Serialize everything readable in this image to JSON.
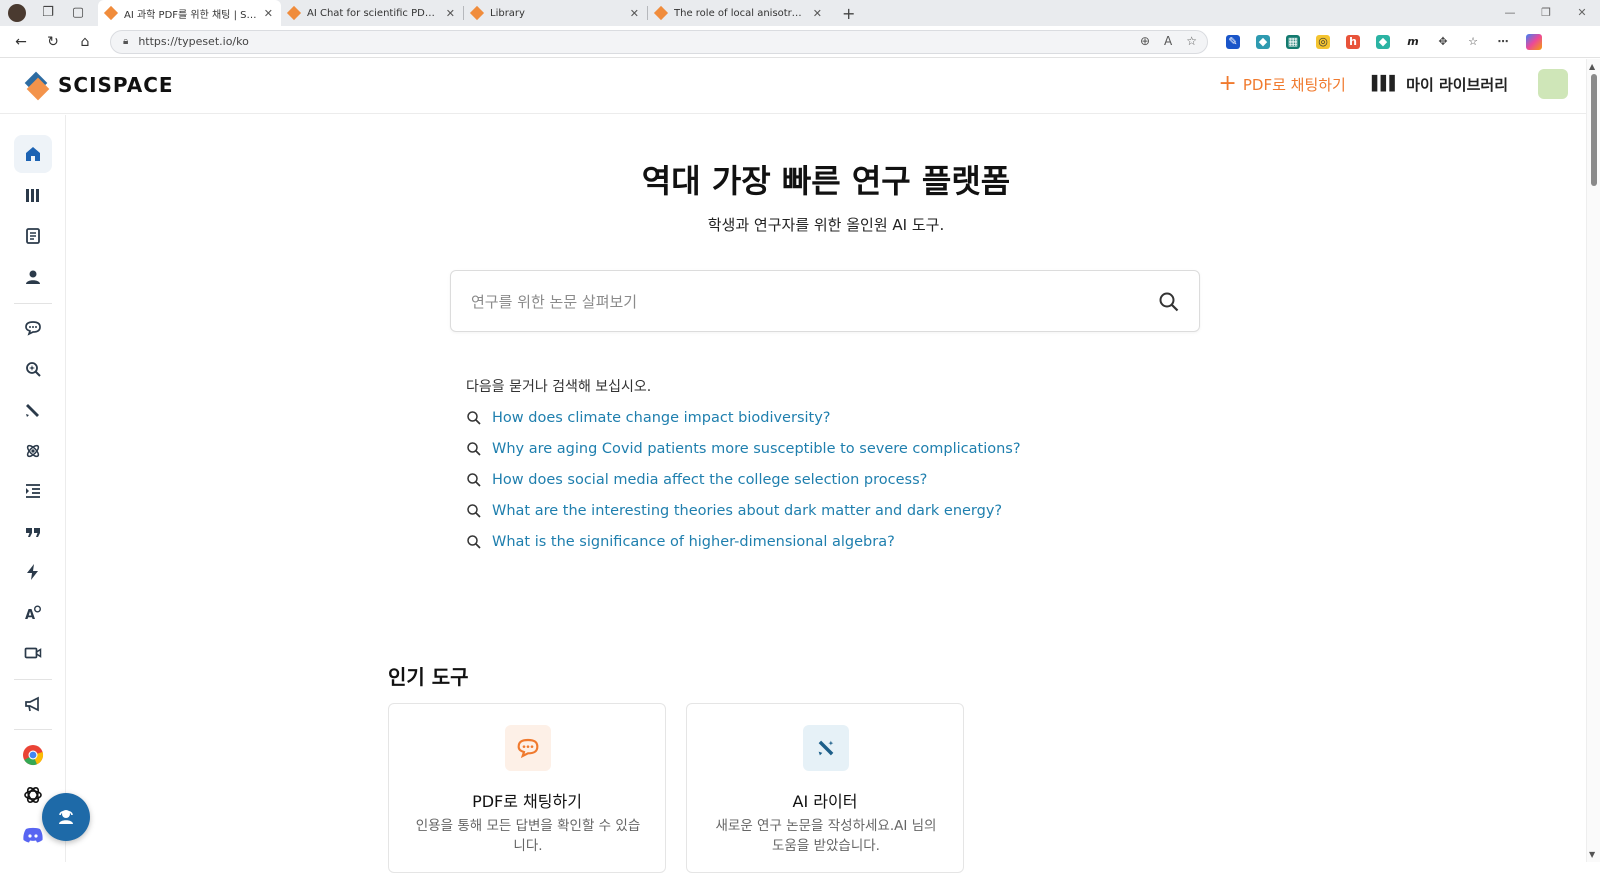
{
  "browser": {
    "tabs": [
      {
        "title": "AI 과학 PDF를 위한 채팅 | SciSpace",
        "active": true
      },
      {
        "title": "AI Chat for scientific PDFs | SciSpace",
        "active": false
      },
      {
        "title": "Library",
        "active": false
      },
      {
        "title": "The role of local anisotropy profiles",
        "active": false
      }
    ],
    "new_tab": "+",
    "url": "https://typeset.io/ko"
  },
  "header": {
    "logo_text": "SCISPACE",
    "chat_pdf_label": "PDF로 채팅하기",
    "library_label": "마이 라이브러리"
  },
  "sidebar": {
    "items": [
      {
        "name": "home-icon",
        "glyph": "⌂"
      },
      {
        "name": "library-icon",
        "glyph": "▥"
      },
      {
        "name": "document-icon",
        "glyph": "▤"
      },
      {
        "name": "user-icon",
        "glyph": "●"
      },
      {
        "name": "chat-icon",
        "glyph": "◔"
      },
      {
        "name": "search-sparkle-icon",
        "glyph": "⚲"
      },
      {
        "name": "pen-icon",
        "glyph": "✎"
      },
      {
        "name": "atom-icon",
        "glyph": "⚛"
      },
      {
        "name": "outline-icon",
        "glyph": "☰"
      },
      {
        "name": "quote-icon",
        "glyph": "❞"
      },
      {
        "name": "bolt-icon",
        "glyph": "⚡"
      },
      {
        "name": "ai-detector-icon",
        "glyph": "A"
      },
      {
        "name": "video-icon",
        "glyph": "▭"
      },
      {
        "name": "megaphone-icon",
        "glyph": "◀"
      },
      {
        "name": "chrome-icon",
        "glyph": "◉"
      },
      {
        "name": "openai-icon",
        "glyph": "✺"
      },
      {
        "name": "discord-icon",
        "glyph": "◙"
      }
    ]
  },
  "hero": {
    "title": "역대 가장 빠른 연구 플랫폼",
    "subtitle": "학생과 연구자를 위한 올인원 AI 도구."
  },
  "search": {
    "placeholder": "연구를 위한 논문 살펴보기"
  },
  "suggestions": {
    "intro": "다음을 묻거나 검색해 보십시오.",
    "items": [
      "How does climate change impact biodiversity?",
      "Why are aging Covid patients more susceptible to severe complications?",
      "How does social media affect the college selection process?",
      "What are the interesting theories about dark matter and dark energy?",
      "What is the significance of higher-dimensional algebra?"
    ]
  },
  "popular_tools": {
    "title": "인기 도구",
    "cards": [
      {
        "title": "PDF로 채팅하기",
        "desc": "인용을 통해 모든 답변을 확인할 수 있습니다.",
        "icon": "chat-pdf-icon",
        "color": "#f07a2e",
        "bg": "#fdf0e7"
      },
      {
        "title": "AI 라이터",
        "desc": "새로운 연구 논문을 작성하세요.AI 님의 도움을 받았습니다.",
        "icon": "ai-writer-icon",
        "color": "#1d5f8a",
        "bg": "#e6f1f7"
      }
    ]
  },
  "colors": {
    "accent": "#f07a2e",
    "link": "#1f7fae",
    "brand_blue": "#1e6aa8"
  }
}
